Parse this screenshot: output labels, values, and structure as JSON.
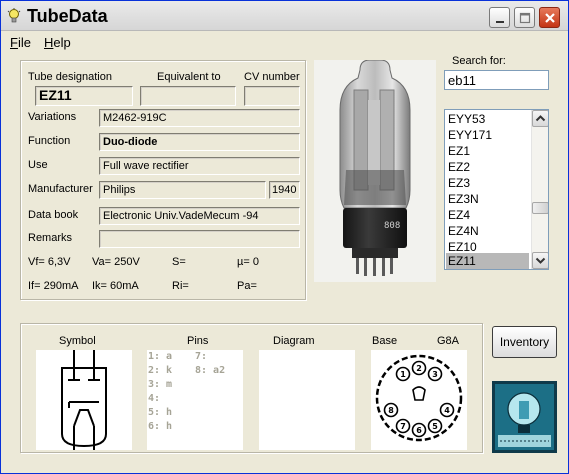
{
  "window": {
    "title": "TubeData"
  },
  "menu": {
    "file": "File",
    "help": "Help"
  },
  "details": {
    "tube_designation_label": "Tube designation",
    "equivalent_label": "Equivalent to",
    "cv_label": "CV number",
    "tube_designation": "EZ11",
    "equivalent": "",
    "cv_number": "",
    "variations_label": "Variations",
    "variations": "M2462-919C",
    "function_label": "Function",
    "function": "Duo-diode",
    "use_label": "Use",
    "use": "Full wave rectifier",
    "manufacturer_label": "Manufacturer",
    "manufacturer": "Philips",
    "year": "1940",
    "databook_label": "Data book",
    "databook": "Electronic Univ.VadeMecum -94",
    "remarks_label": "Remarks",
    "remarks": "",
    "vf": "Vf= 6,3V",
    "va": "Va= 250V",
    "s": "S=",
    "mu": "µ=   0",
    "if": "If= 290mA",
    "ik": "Ik=  60mA",
    "ri": "Ri=",
    "pa": "Pa="
  },
  "search": {
    "label": "Search for:",
    "value": "eb11"
  },
  "tube_list": {
    "items": [
      "EYY53",
      "EYY171",
      "EZ1",
      "EZ2",
      "EZ3",
      "EZ3N",
      "EZ4",
      "EZ4N",
      "EZ10",
      "EZ11"
    ],
    "selected": "EZ11"
  },
  "bottom": {
    "symbol_label": "Symbol",
    "pins_label": "Pins",
    "diagram_label": "Diagram",
    "base_label": "Base",
    "base_type": "G8A",
    "pins_col1": [
      "1: a",
      "2: k",
      "3: m",
      "4:",
      "5: h",
      "6: h"
    ],
    "pins_col2": [
      "7:",
      "8: a2"
    ],
    "base_pin_numbers": [
      "1",
      "2",
      "3",
      "4",
      "5",
      "6",
      "7",
      "8"
    ]
  },
  "buttons": {
    "inventory": "Inventory"
  },
  "icons": [
    "lightbulb-icon",
    "minimize-icon",
    "maximize-icon",
    "close-icon",
    "scroll-up-icon",
    "scroll-down-icon"
  ]
}
